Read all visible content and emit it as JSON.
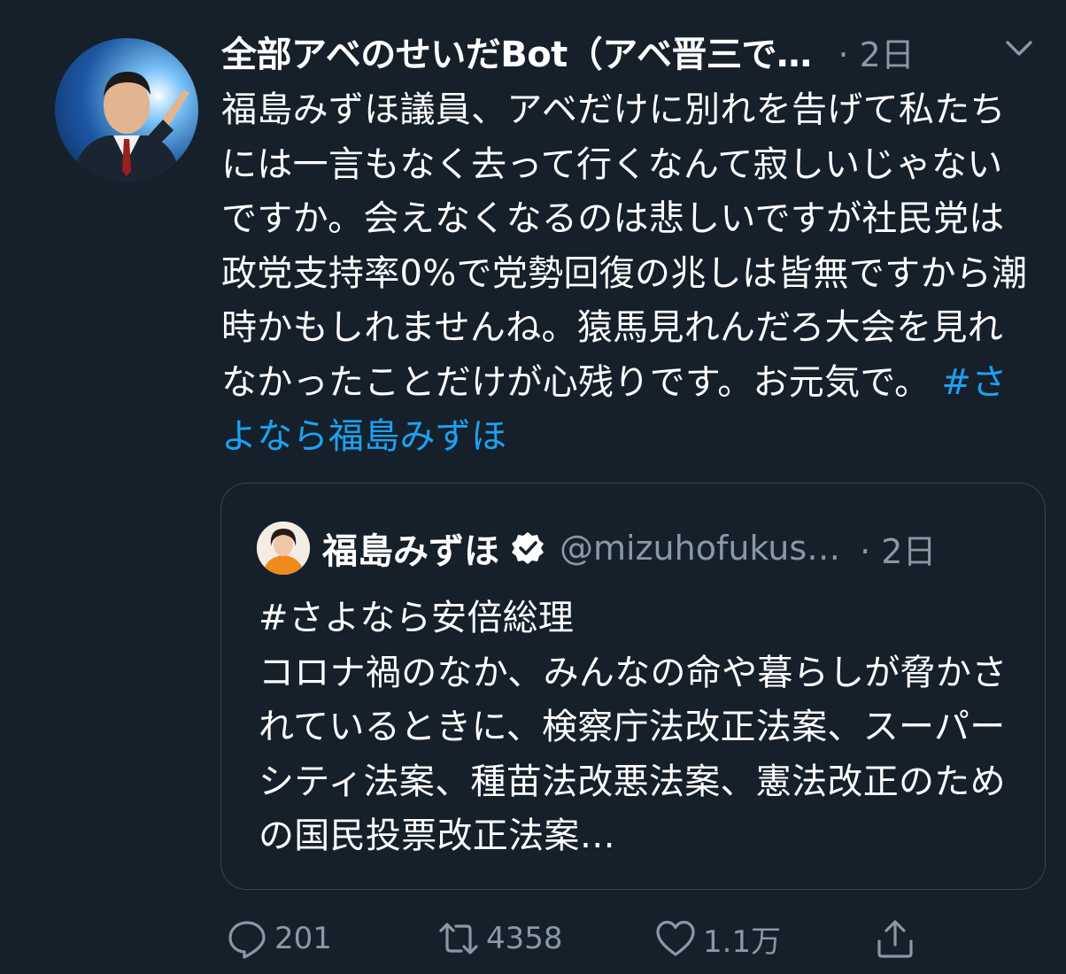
{
  "tweet": {
    "display_name": "全部アベのせいだBot（アベ晋三で…",
    "time": "· 2日",
    "avatar_icon": "profile-photo-icon",
    "body_text": "福島みずほ議員、アベだけに別れを告げて私たちには一言もなく去って行くなんて寂しいじゃないですか。会えなくなるのは悲しいですが社民党は政党支持率0%で党勢回復の兆しは皆無ですから潮時かもしれませんね。猿馬見れんだろ大会を見れなかったことだけが心残りです。お元気で。",
    "hashtag": "#さよなら福島みずほ",
    "menu_icon": "chevron-down-icon"
  },
  "quote": {
    "name": "福島みずほ",
    "handle": "@mizuhofukus…",
    "time": "· 2日",
    "verified_icon": "verified-badge-icon",
    "text": "#さよなら安倍総理\nコロナ禍のなか、みんなの命や暮らしが脅かされているときに、検察庁法改正法案、スーパーシティ法案、種苗法改悪法案、憲法改正のための国民投票改正法案…"
  },
  "actions": {
    "reply_count": "201",
    "retweet_count": "4358",
    "like_count": "1.1万",
    "reply_icon": "reply-icon",
    "retweet_icon": "retweet-icon",
    "like_icon": "heart-icon",
    "share_icon": "share-icon"
  },
  "colors": {
    "background": "#15202b",
    "secondary_text": "#8899a6",
    "link": "#1da1f2",
    "border": "#38444d"
  }
}
